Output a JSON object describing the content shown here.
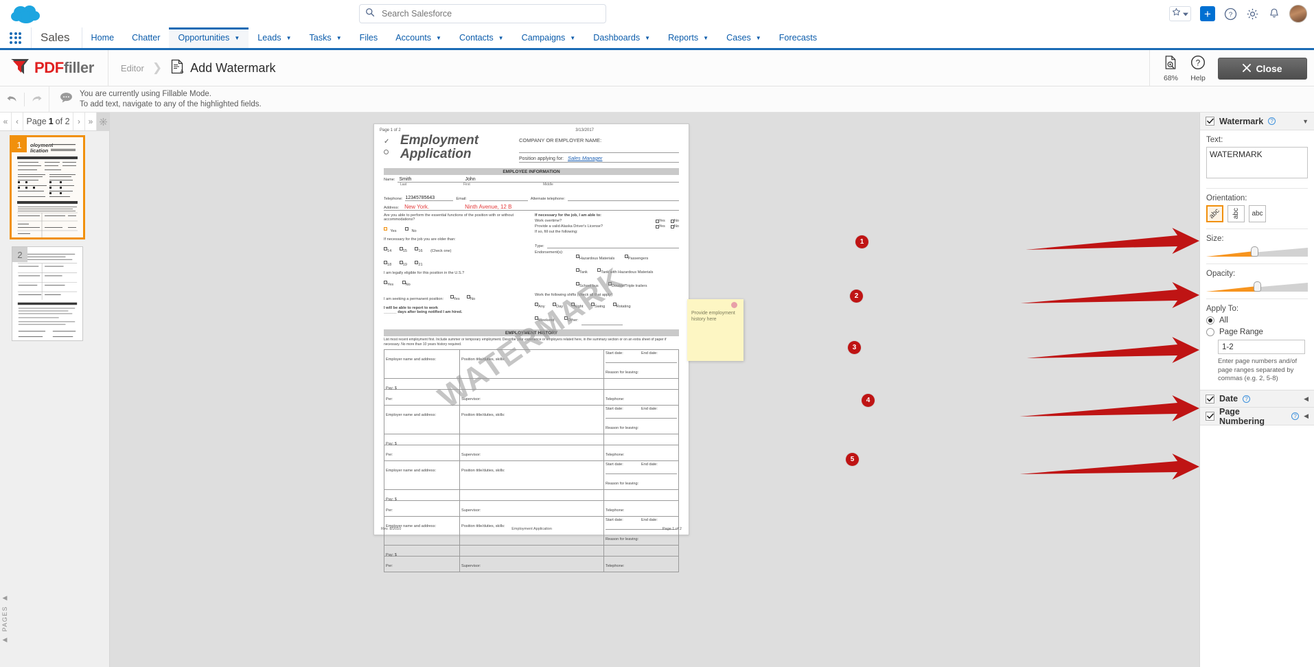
{
  "salesforce": {
    "search": {
      "placeholder": "Search Salesforce",
      "value": ""
    },
    "app_name": "Sales",
    "tabs": [
      {
        "label": "Home",
        "caret": false,
        "active": false
      },
      {
        "label": "Chatter",
        "caret": false,
        "active": false
      },
      {
        "label": "Opportunities",
        "caret": true,
        "active": true
      },
      {
        "label": "Leads",
        "caret": true,
        "active": false
      },
      {
        "label": "Tasks",
        "caret": true,
        "active": false
      },
      {
        "label": "Files",
        "caret": false,
        "active": false
      },
      {
        "label": "Accounts",
        "caret": true,
        "active": false
      },
      {
        "label": "Contacts",
        "caret": true,
        "active": false
      },
      {
        "label": "Campaigns",
        "caret": true,
        "active": false
      },
      {
        "label": "Dashboards",
        "caret": true,
        "active": false
      },
      {
        "label": "Reports",
        "caret": true,
        "active": false
      },
      {
        "label": "Cases",
        "caret": true,
        "active": false
      },
      {
        "label": "Forecasts",
        "caret": false,
        "active": false
      }
    ],
    "accent_blue": "#1a6bb5"
  },
  "pdffiller": {
    "logo_red": "PDF",
    "logo_grey": "filler",
    "breadcrumb_parent": "Editor",
    "breadcrumb_current": "Add Watermark",
    "zoom_level": "68%",
    "help_label": "Help",
    "close_label": "Close",
    "notice_line1": "You are currently using Fillable Mode.",
    "notice_line2": "To add text, navigate to any of the highlighted fields."
  },
  "pages_panel": {
    "nav_prefix": "Page",
    "current_page": "1",
    "nav_middle": "of",
    "total_pages": "2",
    "first_btn": "«",
    "prev_btn": "‹",
    "next_btn": "›",
    "last_btn": "»",
    "vertical_label": "PAGES",
    "thumbs": [
      {
        "number": "1",
        "selected": true
      },
      {
        "number": "2",
        "selected": false
      }
    ]
  },
  "document": {
    "header_left": "Page 1 of 2",
    "header_date": "3/13/2017",
    "title_line1": "Employment",
    "title_line2": "Application",
    "company_label": "COMPANY OR EMPLOYER NAME:",
    "position_label": "Position applying for:",
    "position_value": "Sales Manager",
    "band_employee": "EMPLOYEE INFORMATION",
    "band_history": "EMPLOYMENT HISTORY",
    "name_label": "Name:",
    "name_last": "Smith",
    "name_first": "John",
    "sub_last": "Last",
    "sub_first": "First",
    "sub_middle": "Middle",
    "telephone_label": "Telephone:",
    "telephone_value": "12345785643",
    "email_label": "Email:",
    "alt_phone_label": "Alternate telephone:",
    "address_label": "Address:",
    "address_city": "New York.",
    "address_street": "Ninth Avenue, 12 B",
    "q_functions": "Are you able to perform the essential functions of the position with or without accommodations?",
    "q_age": "If necessary for the job you are older than:",
    "q_eligible": "I am legally eligible for this position in the U.S.?",
    "q_permanent": "I am seeking a permanent position:",
    "q_report": "I will be able to report to work",
    "q_report2": "______ days after being notified I am hired.",
    "q_necessary": "If necessary for the job, I am able to:",
    "q_overtime": "Work overtime?",
    "q_license": "Provide a valid Alaska Driver's License?",
    "q_ifso": "If so, fill out the following:",
    "q_type": "Type:",
    "q_endorsement": "Endorsement(s):",
    "q_shift": "Work the following shifts (check all that apply)",
    "yes": "Yes",
    "no": "No",
    "ages": [
      "14",
      "15",
      "16",
      "18",
      "19",
      "21"
    ],
    "check_one": "(Check one)",
    "endorsements": [
      "Hazardous Materials",
      "Passengers",
      "Tank",
      "Tank with Hazardous Materials",
      "School bus",
      "Double/Triple trailers"
    ],
    "shifts": [
      "Any",
      "Day",
      "Night",
      "Swing",
      "Rotating",
      "Weekend",
      "Other:"
    ],
    "history_note": "List most recent employment first. Include summer or temporary employment. Describe your experience or employers related here, in the summary section or on an extra sheet of paper if necessary. No more than 10 years history required.",
    "col_employer": "Employer name and address:",
    "col_position": "Position title/duties, skills:",
    "col_start": "Start date:",
    "col_end": "End date:",
    "col_reason": "Reason for leaving:",
    "col_pay": "Pay:  $",
    "col_per": "Per:",
    "col_supervisor": "Supervisor:",
    "col_telephone": "Telephone:",
    "footer_rev": "Rev. 8/2010",
    "footer_center": "Employment Application",
    "footer_right": "Page 1 of 2",
    "watermark_preview": "WATERMARK",
    "sticky_note": "Provide employment history here"
  },
  "annotations": [
    {
      "number": "1"
    },
    {
      "number": "2"
    },
    {
      "number": "3"
    },
    {
      "number": "4"
    },
    {
      "number": "5"
    }
  ],
  "settings": {
    "watermark": {
      "title": "Watermark",
      "enabled": true,
      "collapse_arrow": "▼",
      "text_label": "Text:",
      "text_value": "WATERMARK",
      "orientation_label": "Orientation:",
      "orientation_options": [
        {
          "label": "abc",
          "style": "diagonal",
          "selected": true
        },
        {
          "label": "abc",
          "style": "vertical",
          "selected": false
        },
        {
          "label": "abc",
          "style": "horizontal",
          "selected": false
        }
      ],
      "size_label": "Size:",
      "size_percent": 47,
      "opacity_label": "Opacity:",
      "opacity_percent": 50,
      "apply_to_label": "Apply To:",
      "apply_all_label": "All",
      "apply_range_label": "Page Range",
      "apply_selected": "All",
      "page_range_value": "1-2",
      "range_hint": "Enter page numbers and/of page ranges separated by commas (e.g. 2, 5-8)"
    },
    "date": {
      "title": "Date",
      "enabled": true,
      "collapse_arrow": "◀"
    },
    "page_numbering": {
      "title": "Page Numbering",
      "enabled": true,
      "collapse_arrow": "◀"
    }
  },
  "colors": {
    "salesforce_blue": "#1a6bb5",
    "pdffiller_red": "#e02020",
    "accent_orange": "#f1900c",
    "annotation_red": "#bf1414"
  }
}
